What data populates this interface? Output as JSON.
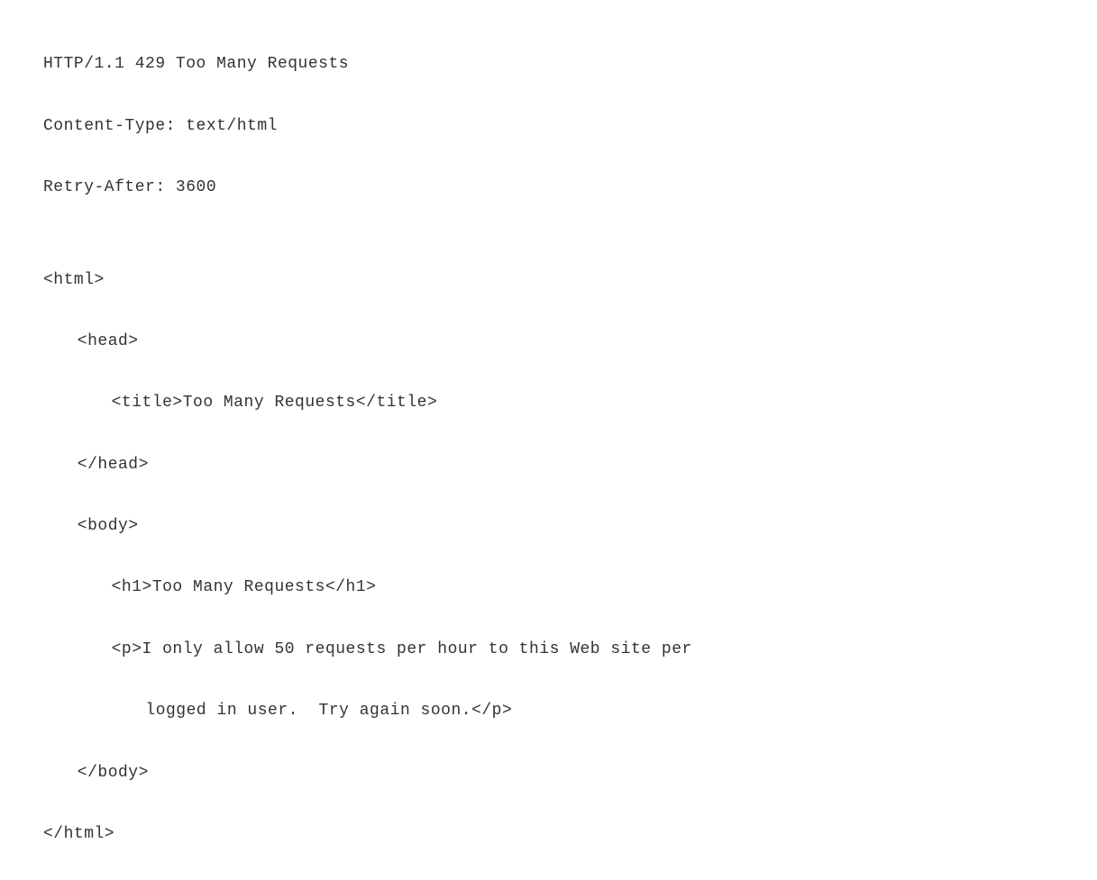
{
  "code": {
    "l1": "HTTP/1.1 429 Too Many Requests",
    "l2": "Content-Type: text/html",
    "l3": "Retry-After: 3600",
    "l4": "",
    "l5": "<html>",
    "l6": "<head>",
    "l7": "<title>Too Many Requests</title>",
    "l8": "</head>",
    "l9": "<body>",
    "l10": "<h1>Too Many Requests</h1>",
    "l11": "<p>I only allow 50 requests per hour to this Web site per",
    "l12": "logged in user.  Try again soon.</p>",
    "l13": "</body>",
    "l14": "</html>"
  }
}
